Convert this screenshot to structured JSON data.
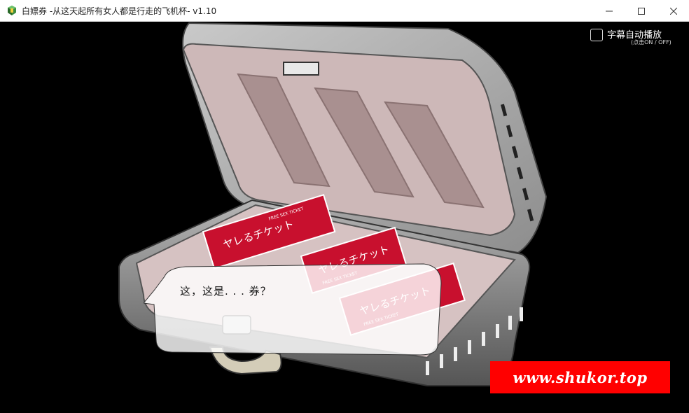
{
  "window": {
    "title": "白嫖券 -从这天起所有女人都是行走的飞机杯- v1.10",
    "icon": "game-app-icon",
    "minimize_icon": "minimize-icon",
    "maximize_icon": "maximize-icon",
    "close_icon": "close-icon"
  },
  "hud": {
    "subtitle_label": "字幕自动播放",
    "subtitle_hint": "(点击ON / OFF)"
  },
  "dialog": {
    "text": "这，这是. . . 券？"
  },
  "tickets": [
    {
      "label": "ヤレるチケット",
      "sub": "FREE SEX TICKET"
    },
    {
      "label": "ヤレるチケット",
      "sub": "FREE SEX TICKET"
    },
    {
      "label": "ヤレるチケット",
      "sub": "FREE SEX TICKET"
    }
  ],
  "watermark": {
    "text": "www.shukor.top"
  },
  "colors": {
    "ticket_red": "#c8102e",
    "watermark_red": "#ff0000",
    "case_silver": "#a8a8a8"
  }
}
